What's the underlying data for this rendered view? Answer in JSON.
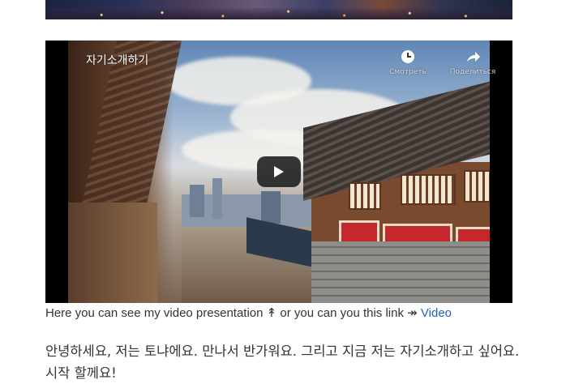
{
  "video": {
    "title": "자기소개하기",
    "actions": [
      {
        "label": "Смотреть",
        "icon": "clock-icon"
      },
      {
        "label": "Поделиться",
        "icon": "share-icon"
      }
    ],
    "play_icon": "play-icon"
  },
  "caption": {
    "text_before": "Here you can see my video presentation",
    "arrow_up": "↟",
    "text_middle": "or you can you this link",
    "arrow_right": "↠",
    "link_label": "Video",
    "link_color": "#1a66c4"
  },
  "paragraph": {
    "text": "안녕하세요, 저는 토냐에요. 만나서 반가워요. 그리고 지금 저는 자기소개하고 싶어요. 시작 할께요!"
  }
}
